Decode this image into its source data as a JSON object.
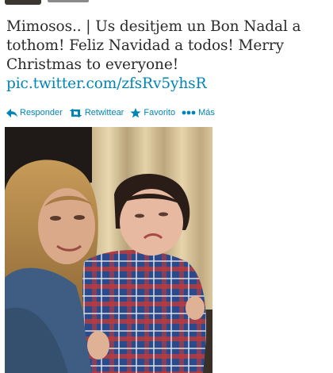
{
  "tweet": {
    "text": "Mimosos.. | Us desitjem un Bon Nadal a tothom! Feliz Navidad a todos! Merry Christmas to everyone!",
    "link": "pic.twitter.com/zfsRv5yhsR"
  },
  "actions": [
    {
      "label": "Responder",
      "icon": "reply-icon"
    },
    {
      "label": "Retwittear",
      "icon": "retweet-icon"
    },
    {
      "label": "Favorito",
      "icon": "star-icon"
    },
    {
      "label": "Más",
      "icon": "more-icon"
    }
  ],
  "colors": {
    "link": "#0084b4",
    "text": "#2b2b2b"
  }
}
